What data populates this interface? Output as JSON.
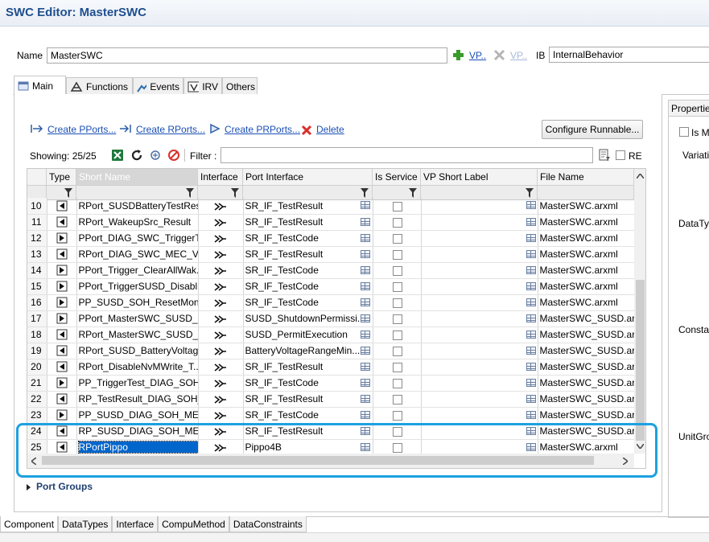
{
  "window": {
    "title": "SWC Editor: MasterSWC"
  },
  "top_form": {
    "name_label": "Name",
    "name_value": "MasterSWC",
    "vp_add_label": "VP..",
    "vp_remove_label": "VP..",
    "ib_label": "IB",
    "ib_value": "InternalBehavior"
  },
  "tabs": [
    {
      "label": "Main",
      "icon": "main-tab-icon",
      "active": true
    },
    {
      "label": "Functions",
      "icon": "functions-icon"
    },
    {
      "label": "Events",
      "icon": "events-icon"
    },
    {
      "label": "IRV",
      "icon": "irv-icon"
    },
    {
      "label": "Others"
    }
  ],
  "actions": {
    "create_pports": "Create PPorts...",
    "create_rports": "Create RPorts...",
    "create_prports": "Create PRPorts...",
    "delete": "Delete",
    "configure_runnable": "Configure Runnable..."
  },
  "toolbar": {
    "showing": "Showing: 25/25",
    "filter_label": "Filter :",
    "filter_value": "",
    "re_label": "RE"
  },
  "table": {
    "columns": [
      "Type",
      "Short Name",
      "Interface",
      "Port Interface",
      "Is Service",
      "VP Short Label",
      "File Name"
    ],
    "rows": [
      {
        "num": "10",
        "type": "R",
        "short_name": "RPort_SUSDBatteryTestRes...",
        "port_interface": "SR_IF_TestResult",
        "file": "MasterSWC.arxml"
      },
      {
        "num": "11",
        "type": "R",
        "short_name": "RPort_WakeupSrc_Result",
        "port_interface": "SR_IF_TestResult",
        "file": "MasterSWC.arxml"
      },
      {
        "num": "12",
        "type": "P",
        "short_name": "PPort_DIAG_SWC_TriggerT...",
        "port_interface": "SR_IF_TestCode",
        "file": "MasterSWC.arxml"
      },
      {
        "num": "13",
        "type": "R",
        "short_name": "RPort_DIAG_SWC_MEC_Va...",
        "port_interface": "SR_IF_TestResult",
        "file": "MasterSWC.arxml"
      },
      {
        "num": "14",
        "type": "P",
        "short_name": "PPort_Trigger_ClearAllWak...",
        "port_interface": "SR_IF_TestCode",
        "file": "MasterSWC.arxml"
      },
      {
        "num": "15",
        "type": "P",
        "short_name": "PPort_TriggerSUSD_Disabl...",
        "port_interface": "SR_IF_TestCode",
        "file": "MasterSWC.arxml"
      },
      {
        "num": "16",
        "type": "P",
        "short_name": "PP_SUSD_SOH_ResetMoni...",
        "port_interface": "SR_IF_TestCode",
        "file": "MasterSWC.arxml"
      },
      {
        "num": "17",
        "type": "P",
        "short_name": "PPort_MasterSWC_SUSD_S...",
        "port_interface": "SUSD_ShutdownPermissi...",
        "file": "MasterSWC_SUSD.arxml"
      },
      {
        "num": "18",
        "type": "R",
        "short_name": "RPort_MasterSWC_SUSD_...",
        "port_interface": "SUSD_PermitExecution",
        "file": "MasterSWC_SUSD.arxml"
      },
      {
        "num": "19",
        "type": "R",
        "short_name": "RPort_SUSD_BatteryVoltag...",
        "port_interface": "BatteryVoltageRangeMin...",
        "file": "MasterSWC_SUSD.arxml"
      },
      {
        "num": "20",
        "type": "R",
        "short_name": "RPort_DisableNvMWrite_T...",
        "port_interface": "SR_IF_TestResult",
        "file": "MasterSWC_SUSD.arxml"
      },
      {
        "num": "21",
        "type": "P",
        "short_name": "PP_TriggerTest_DIAG_SOH...",
        "port_interface": "SR_IF_TestCode",
        "file": "MasterSWC_SUSD.arxml"
      },
      {
        "num": "22",
        "type": "R",
        "short_name": "RP_TestResult_DIAG_SOH_...",
        "port_interface": "SR_IF_TestResult",
        "file": "MasterSWC_SUSD.arxml"
      },
      {
        "num": "23",
        "type": "P",
        "short_name": "PP_SUSD_DIAG_SOH_MEC...",
        "port_interface": "SR_IF_TestCode",
        "file": "MasterSWC_SUSD.arxml"
      },
      {
        "num": "24",
        "type": "R",
        "short_name": "RP_SUSD_DIAG_SOH_MEC...",
        "port_interface": "SR_IF_TestResult",
        "file": "MasterSWC_SUSD.arxml"
      },
      {
        "num": "25",
        "type": "R",
        "short_name": "RPortPippo",
        "port_interface": "Pippo4B",
        "file": "MasterSWC.arxml",
        "selected": true
      }
    ]
  },
  "port_groups": {
    "label": "Port Groups"
  },
  "properties": {
    "title": "Properties",
    "is_m_label": "Is M",
    "variation_label": "Variati",
    "datatype_label": "DataTyp",
    "consta_label": "Consta",
    "unitgro_label": "UnitGro"
  },
  "bottom_tabs": [
    "Component",
    "DataTypes",
    "Interface",
    "CompuMethod",
    "DataConstraints"
  ],
  "colors": {
    "title": "#1f4f8f",
    "link": "#1a4fb5",
    "highlight": "#1da1e0",
    "selection": "#0066cc",
    "delete_red": "#d9302c",
    "add_green": "#3a9a2a"
  }
}
